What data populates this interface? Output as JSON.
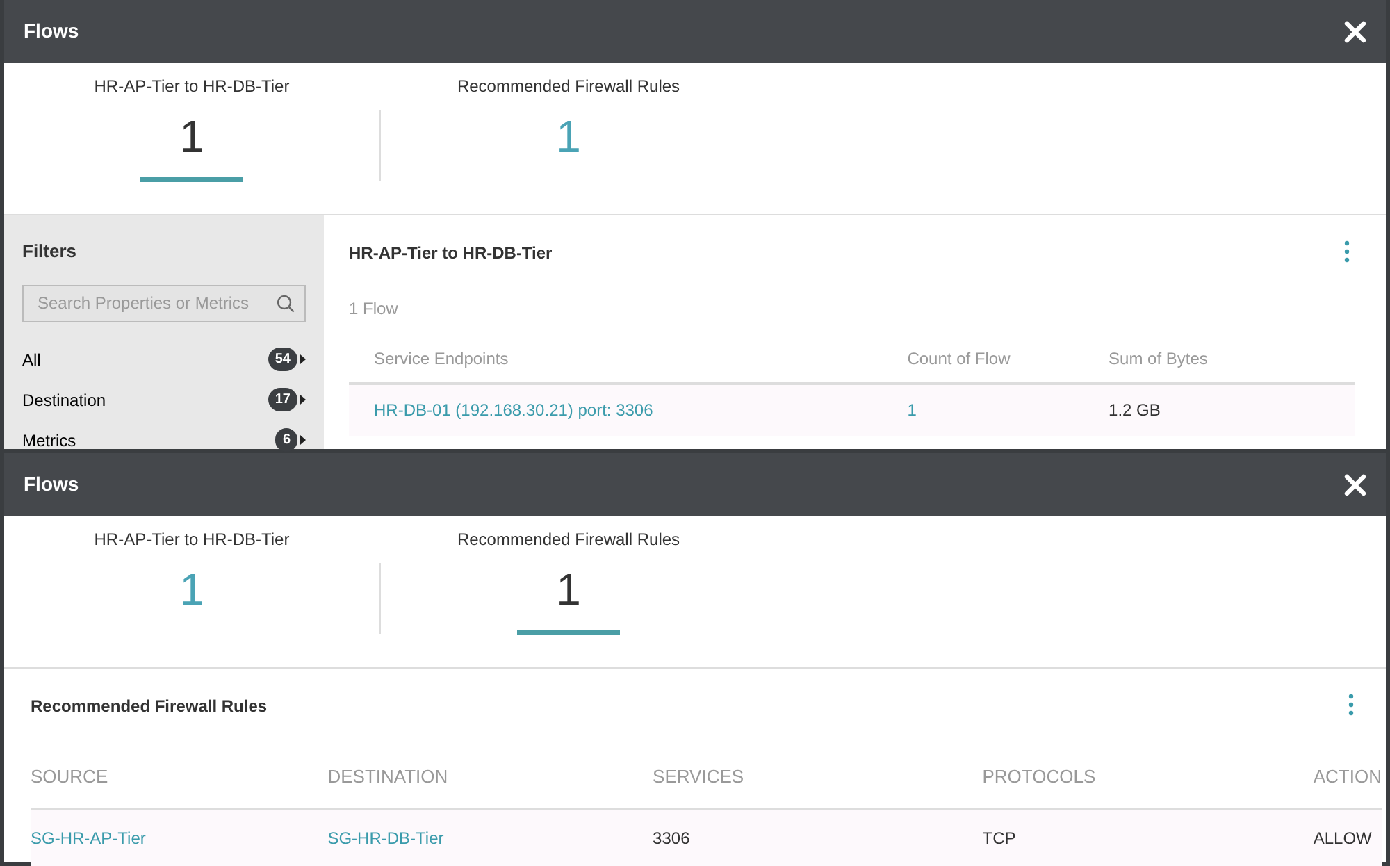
{
  "panels": [
    {
      "title": "Flows",
      "tabs": [
        {
          "label": "HR-AP-Tier to HR-DB-Tier",
          "count": "1",
          "selected": true
        },
        {
          "label": "Recommended Firewall Rules",
          "count": "1",
          "selected": false
        }
      ],
      "kind": "flows",
      "filters": {
        "title": "Filters",
        "search": {
          "placeholder": "Search Properties or Metrics"
        },
        "items": [
          {
            "label": "All",
            "count": "54"
          },
          {
            "label": "Destination",
            "count": "17"
          },
          {
            "label": "Metrics",
            "count": "6"
          }
        ]
      },
      "section_title": "HR-AP-Tier to HR-DB-Tier",
      "summary": "1 Flow",
      "table": {
        "columns": [
          "Service Endpoints",
          "Count of Flow",
          "Sum of Bytes"
        ],
        "rows": [
          [
            {
              "text": "HR-DB-01 (192.168.30.21) port: 3306",
              "link": true
            },
            {
              "text": "1",
              "link": true
            },
            {
              "text": "1.2 GB",
              "link": false
            }
          ]
        ]
      }
    },
    {
      "title": "Flows",
      "tabs": [
        {
          "label": "HR-AP-Tier to HR-DB-Tier",
          "count": "1",
          "selected": false
        },
        {
          "label": "Recommended Firewall Rules",
          "count": "1",
          "selected": true
        }
      ],
      "kind": "rules",
      "section_title": "Recommended Firewall Rules",
      "table": {
        "columns": [
          "SOURCE",
          "DESTINATION",
          "SERVICES",
          "PROTOCOLS",
          "ACTION"
        ],
        "rows": [
          [
            {
              "text": "SG-HR-AP-Tier",
              "link": true
            },
            {
              "text": "SG-HR-DB-Tier",
              "link": true
            },
            {
              "text": "3306",
              "link": false
            },
            {
              "text": "TCP",
              "link": false
            },
            {
              "text": "ALLOW",
              "link": false
            }
          ]
        ]
      }
    }
  ]
}
